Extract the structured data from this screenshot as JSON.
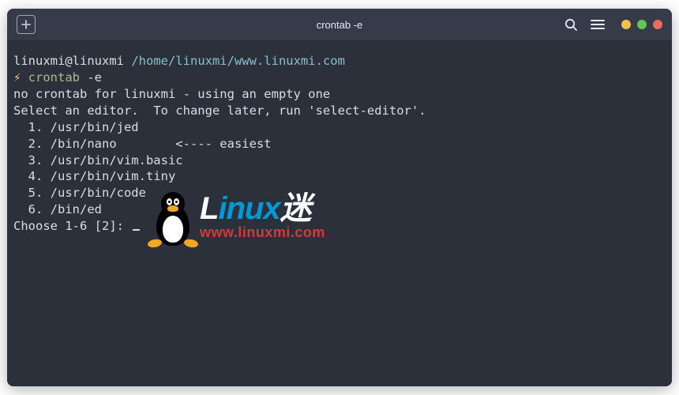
{
  "titlebar": {
    "title": "crontab -e"
  },
  "prompt": {
    "user_host": "linuxmi@linuxmi",
    "cwd": "/home/linuxmi/www.linuxmi.com",
    "bolt": "⚡",
    "command": "crontab",
    "arg": " -e"
  },
  "output": {
    "no_crontab": "no crontab for linuxmi - using an empty one",
    "blank1": "",
    "select_editor": "Select an editor.  To change later, run 'select-editor'.",
    "opt1": "  1. /usr/bin/jed",
    "opt2": "  2. /bin/nano        <---- easiest",
    "opt3": "  3. /usr/bin/vim.basic",
    "opt4": "  4. /usr/bin/vim.tiny",
    "opt5": "  5. /usr/bin/code",
    "opt6": "  6. /bin/ed",
    "blank2": "",
    "choose": "Choose 1-6 [2]: "
  },
  "watermark": {
    "chars": {
      "L": "L",
      "inux": "inux",
      "mi": "迷"
    },
    "url": "www.linuxmi.com"
  }
}
